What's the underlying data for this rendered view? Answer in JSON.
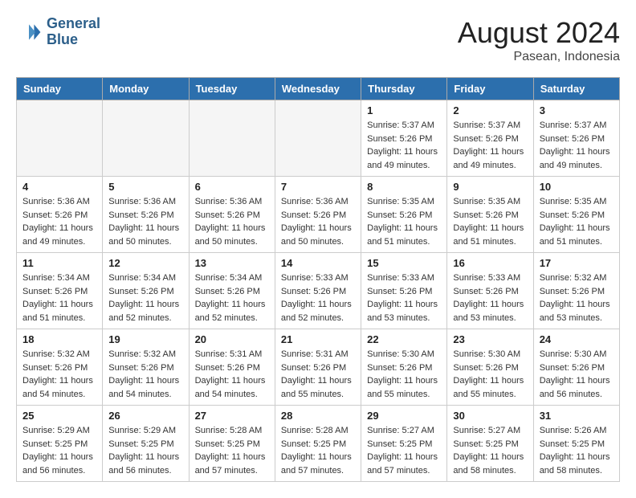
{
  "header": {
    "logo_line1": "General",
    "logo_line2": "Blue",
    "month": "August 2024",
    "location": "Pasean, Indonesia"
  },
  "weekdays": [
    "Sunday",
    "Monday",
    "Tuesday",
    "Wednesday",
    "Thursday",
    "Friday",
    "Saturday"
  ],
  "weeks": [
    [
      {
        "day": "",
        "info": ""
      },
      {
        "day": "",
        "info": ""
      },
      {
        "day": "",
        "info": ""
      },
      {
        "day": "",
        "info": ""
      },
      {
        "day": "1",
        "info": "Sunrise: 5:37 AM\nSunset: 5:26 PM\nDaylight: 11 hours\nand 49 minutes."
      },
      {
        "day": "2",
        "info": "Sunrise: 5:37 AM\nSunset: 5:26 PM\nDaylight: 11 hours\nand 49 minutes."
      },
      {
        "day": "3",
        "info": "Sunrise: 5:37 AM\nSunset: 5:26 PM\nDaylight: 11 hours\nand 49 minutes."
      }
    ],
    [
      {
        "day": "4",
        "info": "Sunrise: 5:36 AM\nSunset: 5:26 PM\nDaylight: 11 hours\nand 49 minutes."
      },
      {
        "day": "5",
        "info": "Sunrise: 5:36 AM\nSunset: 5:26 PM\nDaylight: 11 hours\nand 50 minutes."
      },
      {
        "day": "6",
        "info": "Sunrise: 5:36 AM\nSunset: 5:26 PM\nDaylight: 11 hours\nand 50 minutes."
      },
      {
        "day": "7",
        "info": "Sunrise: 5:36 AM\nSunset: 5:26 PM\nDaylight: 11 hours\nand 50 minutes."
      },
      {
        "day": "8",
        "info": "Sunrise: 5:35 AM\nSunset: 5:26 PM\nDaylight: 11 hours\nand 51 minutes."
      },
      {
        "day": "9",
        "info": "Sunrise: 5:35 AM\nSunset: 5:26 PM\nDaylight: 11 hours\nand 51 minutes."
      },
      {
        "day": "10",
        "info": "Sunrise: 5:35 AM\nSunset: 5:26 PM\nDaylight: 11 hours\nand 51 minutes."
      }
    ],
    [
      {
        "day": "11",
        "info": "Sunrise: 5:34 AM\nSunset: 5:26 PM\nDaylight: 11 hours\nand 51 minutes."
      },
      {
        "day": "12",
        "info": "Sunrise: 5:34 AM\nSunset: 5:26 PM\nDaylight: 11 hours\nand 52 minutes."
      },
      {
        "day": "13",
        "info": "Sunrise: 5:34 AM\nSunset: 5:26 PM\nDaylight: 11 hours\nand 52 minutes."
      },
      {
        "day": "14",
        "info": "Sunrise: 5:33 AM\nSunset: 5:26 PM\nDaylight: 11 hours\nand 52 minutes."
      },
      {
        "day": "15",
        "info": "Sunrise: 5:33 AM\nSunset: 5:26 PM\nDaylight: 11 hours\nand 53 minutes."
      },
      {
        "day": "16",
        "info": "Sunrise: 5:33 AM\nSunset: 5:26 PM\nDaylight: 11 hours\nand 53 minutes."
      },
      {
        "day": "17",
        "info": "Sunrise: 5:32 AM\nSunset: 5:26 PM\nDaylight: 11 hours\nand 53 minutes."
      }
    ],
    [
      {
        "day": "18",
        "info": "Sunrise: 5:32 AM\nSunset: 5:26 PM\nDaylight: 11 hours\nand 54 minutes."
      },
      {
        "day": "19",
        "info": "Sunrise: 5:32 AM\nSunset: 5:26 PM\nDaylight: 11 hours\nand 54 minutes."
      },
      {
        "day": "20",
        "info": "Sunrise: 5:31 AM\nSunset: 5:26 PM\nDaylight: 11 hours\nand 54 minutes."
      },
      {
        "day": "21",
        "info": "Sunrise: 5:31 AM\nSunset: 5:26 PM\nDaylight: 11 hours\nand 55 minutes."
      },
      {
        "day": "22",
        "info": "Sunrise: 5:30 AM\nSunset: 5:26 PM\nDaylight: 11 hours\nand 55 minutes."
      },
      {
        "day": "23",
        "info": "Sunrise: 5:30 AM\nSunset: 5:26 PM\nDaylight: 11 hours\nand 55 minutes."
      },
      {
        "day": "24",
        "info": "Sunrise: 5:30 AM\nSunset: 5:26 PM\nDaylight: 11 hours\nand 56 minutes."
      }
    ],
    [
      {
        "day": "25",
        "info": "Sunrise: 5:29 AM\nSunset: 5:25 PM\nDaylight: 11 hours\nand 56 minutes."
      },
      {
        "day": "26",
        "info": "Sunrise: 5:29 AM\nSunset: 5:25 PM\nDaylight: 11 hours\nand 56 minutes."
      },
      {
        "day": "27",
        "info": "Sunrise: 5:28 AM\nSunset: 5:25 PM\nDaylight: 11 hours\nand 57 minutes."
      },
      {
        "day": "28",
        "info": "Sunrise: 5:28 AM\nSunset: 5:25 PM\nDaylight: 11 hours\nand 57 minutes."
      },
      {
        "day": "29",
        "info": "Sunrise: 5:27 AM\nSunset: 5:25 PM\nDaylight: 11 hours\nand 57 minutes."
      },
      {
        "day": "30",
        "info": "Sunrise: 5:27 AM\nSunset: 5:25 PM\nDaylight: 11 hours\nand 58 minutes."
      },
      {
        "day": "31",
        "info": "Sunrise: 5:26 AM\nSunset: 5:25 PM\nDaylight: 11 hours\nand 58 minutes."
      }
    ]
  ]
}
